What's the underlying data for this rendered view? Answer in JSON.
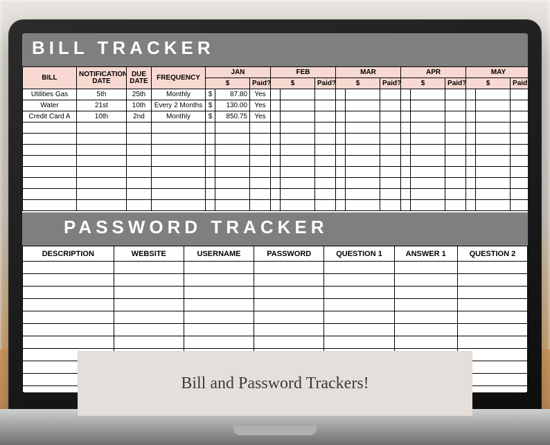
{
  "billTracker": {
    "title": "BILL TRACKER",
    "fixedHeaders": [
      "BILL",
      "NOTIFICATION DATE",
      "DUE DATE",
      "FREQUENCY"
    ],
    "months": [
      "JAN",
      "FEB",
      "MAR",
      "APR",
      "MAY",
      ""
    ],
    "monthSub": [
      "$",
      "Paid?"
    ],
    "rows": [
      {
        "bill": "Utilities Gas",
        "notif": "5th",
        "due": "25th",
        "freq": "Monthly",
        "months": [
          {
            "amt": "87.80",
            "paid": "Yes"
          },
          {},
          {},
          {},
          {},
          {}
        ]
      },
      {
        "bill": "Water",
        "notif": "21st",
        "due": "10th",
        "freq": "Every 2 Months",
        "months": [
          {
            "amt": "130.00",
            "paid": "Yes"
          },
          {},
          {},
          {},
          {},
          {}
        ]
      },
      {
        "bill": "Credit Card A",
        "notif": "10th",
        "due": "2nd",
        "freq": "Monthly",
        "months": [
          {
            "amt": "850.75",
            "paid": "Yes"
          },
          {},
          {},
          {},
          {},
          {}
        ]
      }
    ],
    "blankRows": 8
  },
  "pwTracker": {
    "title": "PASSWORD TRACKER",
    "headers": [
      "DESCRIPTION",
      "WEBSITE",
      "USERNAME",
      "PASSWORD",
      "QUESTION 1",
      "ANSWER 1",
      "QUESTION 2"
    ],
    "blankRows": 12
  },
  "caption": "Bill and Password Trackers!"
}
